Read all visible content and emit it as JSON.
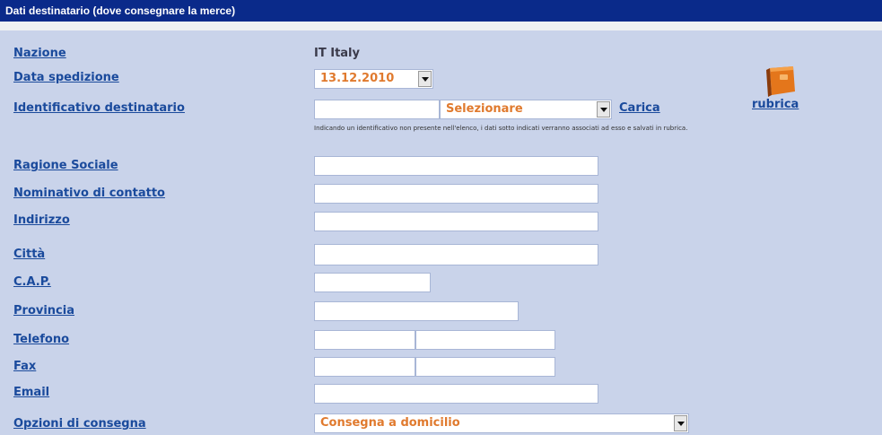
{
  "header": {
    "title": "Dati destinatario (dove consegnare la merce)"
  },
  "colors": {
    "header_bg": "#0a2a8a",
    "panel_bg": "#c9d3ea",
    "label": "#1a4a9c",
    "accent": "#e07a2e"
  },
  "fields": {
    "nazione": {
      "label": "Nazione",
      "value": "IT Italy"
    },
    "data_spedizione": {
      "label": "Data spedizione",
      "value": "13.12.2010"
    },
    "identificativo": {
      "label": "Identificativo destinatario",
      "select_value": "Selezionare",
      "load_link": "Carica",
      "rubrica_link": "rubrica",
      "note": "Indicando un identificativo non presente nell'elenco, i dati sotto indicati verranno associati ad esso e salvati in rubrica."
    },
    "ragione_sociale": {
      "label": "Ragione Sociale"
    },
    "nominativo": {
      "label": "Nominativo di contatto"
    },
    "indirizzo": {
      "label": "Indirizzo"
    },
    "citta": {
      "label": "Città"
    },
    "cap": {
      "label": "C.A.P."
    },
    "provincia": {
      "label": "Provincia"
    },
    "telefono": {
      "label": "Telefono"
    },
    "fax": {
      "label": "Fax"
    },
    "email": {
      "label": "Email"
    },
    "opzioni_consegna": {
      "label": "Opzioni di consegna",
      "value": "Consegna a domicilio"
    }
  },
  "icons": {
    "rubrica": "address-book-icon"
  }
}
